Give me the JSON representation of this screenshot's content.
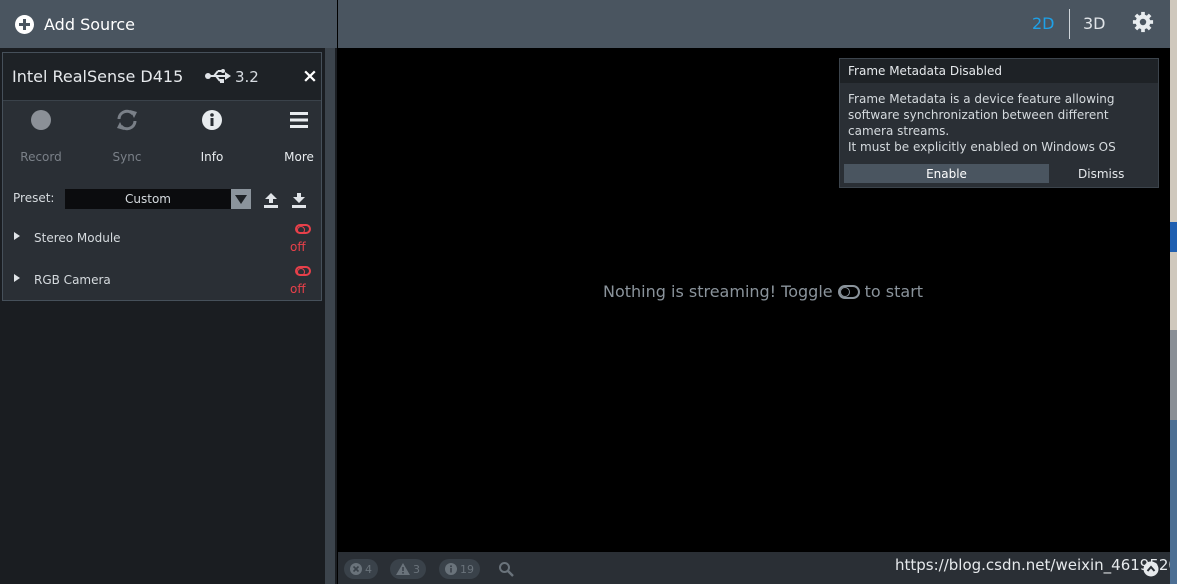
{
  "sidebar": {
    "add_source_label": "Add Source",
    "device": {
      "name": "Intel RealSense D415",
      "usb_version": "3.2",
      "close_label": "×",
      "tools": [
        {
          "label": "Record",
          "icon": "record-icon"
        },
        {
          "label": "Sync",
          "icon": "sync-icon"
        },
        {
          "label": "Info",
          "icon": "info-icon"
        },
        {
          "label": "More",
          "icon": "menu-icon"
        }
      ],
      "preset": {
        "label": "Preset:",
        "value": "Custom"
      },
      "modules": [
        {
          "name": "Stereo Module",
          "state": "off"
        },
        {
          "name": "RGB Camera",
          "state": "off"
        }
      ]
    }
  },
  "topbar": {
    "view_2d": "2D",
    "view_3d": "3D",
    "active_view": "2D"
  },
  "viewport": {
    "empty_message_before": "Nothing is streaming! Toggle",
    "empty_message_after": "to start"
  },
  "notification": {
    "title": "Frame Metadata Disabled",
    "body_lines": [
      "Frame Metadata is a device feature allowing",
      "software synchronization between different",
      "camera streams.",
      "It must be explicitly enabled on Windows OS"
    ],
    "enable_label": "Enable",
    "dismiss_label": "Dismiss"
  },
  "statusbar": {
    "errors_count": "4",
    "warnings_count": "3",
    "info_count": "19",
    "watermark": "https://blog.csdn.net/weixin_46195203"
  },
  "colors": {
    "accent": "#1ea1e8",
    "off_red": "#e8404a",
    "topbar_bg": "#4a5560",
    "panel_bg": "#2a2f35"
  }
}
